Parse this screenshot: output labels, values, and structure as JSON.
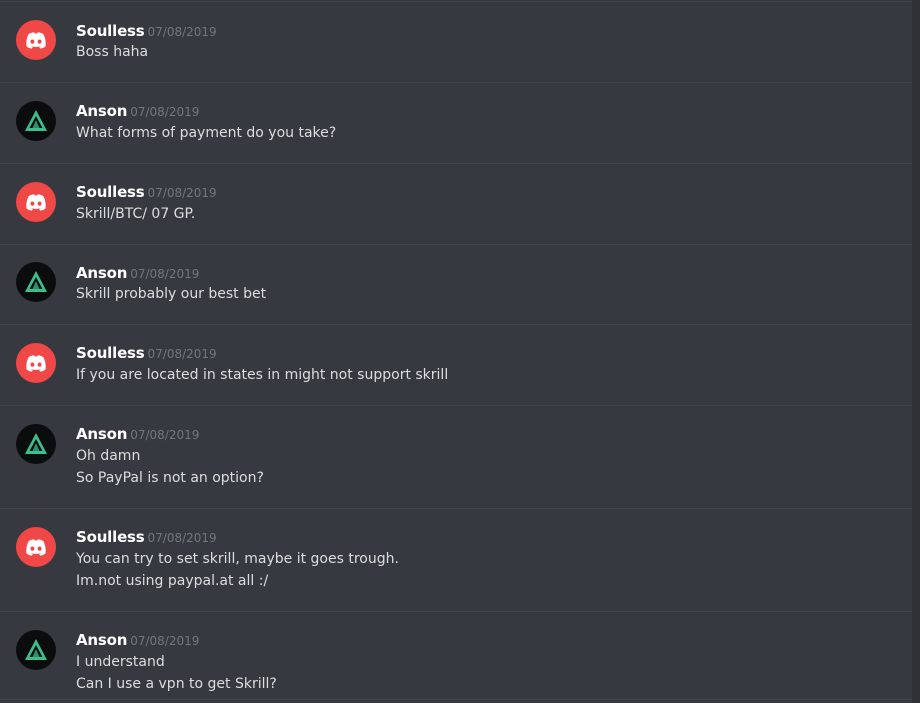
{
  "messages": [
    {
      "author": "Soulless",
      "avatar_icon": "discord-logo-icon",
      "timestamp": "07/08/2019",
      "lines": [
        "Boss haha"
      ]
    },
    {
      "author": "Anson",
      "avatar_icon": "triangle-logo-icon",
      "timestamp": "07/08/2019",
      "lines": [
        "What forms of payment do you take?"
      ]
    },
    {
      "author": "Soulless",
      "avatar_icon": "discord-logo-icon",
      "timestamp": "07/08/2019",
      "lines": [
        "Skrill/BTC/ 07 GP."
      ]
    },
    {
      "author": "Anson",
      "avatar_icon": "triangle-logo-icon",
      "timestamp": "07/08/2019",
      "lines": [
        "Skrill probably our best bet"
      ]
    },
    {
      "author": "Soulless",
      "avatar_icon": "discord-logo-icon",
      "timestamp": "07/08/2019",
      "lines": [
        "If you are located in states in might not support skrill"
      ]
    },
    {
      "author": "Anson",
      "avatar_icon": "triangle-logo-icon",
      "timestamp": "07/08/2019",
      "lines": [
        "Oh damn",
        "So PayPal is not an option?"
      ]
    },
    {
      "author": "Soulless",
      "avatar_icon": "discord-logo-icon",
      "timestamp": "07/08/2019",
      "lines": [
        "You can try to set skrill, maybe it goes trough.",
        "Im.not using paypal.at all :/"
      ]
    },
    {
      "author": "Anson",
      "avatar_icon": "triangle-logo-icon",
      "timestamp": "07/08/2019",
      "lines": [
        "I understand",
        "Can I use a vpn to get Skrill?"
      ]
    }
  ],
  "colors": {
    "background": "#36393f",
    "author_name": "#ffffff",
    "timestamp": "#72767d",
    "message_text": "#dcddde",
    "discord_avatar": "#f04747",
    "anson_avatar_bg": "#0b0c0d",
    "anson_logo_green": "#3bbf8e"
  }
}
